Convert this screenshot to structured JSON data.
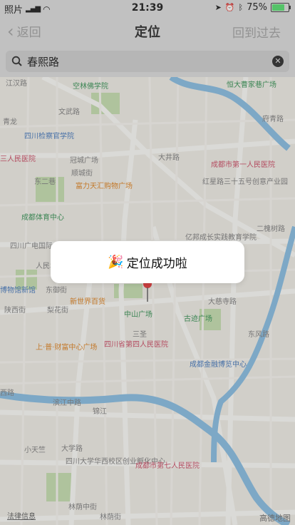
{
  "status": {
    "left_label": "照片",
    "time": "21:39",
    "battery": "75%",
    "battery_level": 0.75
  },
  "nav": {
    "back": "返回",
    "title": "定位",
    "right": "回到过去"
  },
  "search": {
    "value": "春熙路"
  },
  "toast": {
    "text": "定位成功啦",
    "icon": "party-popper-icon"
  },
  "map": {
    "legal": "法律信息",
    "brand": "高德地图",
    "labels": [
      {
        "t": "江汉路",
        "c": "street"
      },
      {
        "t": "空林佛学院",
        "c": "green"
      },
      {
        "t": "恒大曹家巷广场",
        "c": "green"
      },
      {
        "t": "青龙",
        "c": "street"
      },
      {
        "t": "文武路",
        "c": "street"
      },
      {
        "t": "府青路",
        "c": "street"
      },
      {
        "t": "四川检察官学院",
        "c": "blue"
      },
      {
        "t": "成都市第一人民医院",
        "c": "red"
      },
      {
        "t": "三人民医院",
        "c": "red"
      },
      {
        "t": "冠城广场",
        "c": "street"
      },
      {
        "t": "大井路",
        "c": "street"
      },
      {
        "t": "顺城街",
        "c": "street"
      },
      {
        "t": "东二巷",
        "c": "street"
      },
      {
        "t": "富力天汇购物广场",
        "c": "orange"
      },
      {
        "t": "红星路三十五号创意产业园",
        "c": "street"
      },
      {
        "t": "成都体育中心",
        "c": "green"
      },
      {
        "t": "二槐树路",
        "c": "street"
      },
      {
        "t": "亿邦成长实践教育学院",
        "c": "street"
      },
      {
        "t": "四川广电国际",
        "c": "street"
      },
      {
        "t": "人民北",
        "c": "street"
      },
      {
        "t": "博物馆新馆",
        "c": "blue"
      },
      {
        "t": "东御街",
        "c": "street"
      },
      {
        "t": "新世界百货",
        "c": "orange"
      },
      {
        "t": "大慈寺路",
        "c": "street"
      },
      {
        "t": "陕西街",
        "c": "street"
      },
      {
        "t": "梨花街",
        "c": "street"
      },
      {
        "t": "中山广场",
        "c": "green"
      },
      {
        "t": "古迹广场",
        "c": "green"
      },
      {
        "t": "三圣",
        "c": "street"
      },
      {
        "t": "东风路",
        "c": "street"
      },
      {
        "t": "上·普·财富中心广场",
        "c": "orange"
      },
      {
        "t": "四川省第四人民医院",
        "c": "red"
      },
      {
        "t": "成都金融博览中心",
        "c": "blue"
      },
      {
        "t": "西路",
        "c": "street"
      },
      {
        "t": "滨江中路",
        "c": "street"
      },
      {
        "t": "锦江",
        "c": "street"
      },
      {
        "t": "小天竺",
        "c": "street"
      },
      {
        "t": "大学路",
        "c": "street"
      },
      {
        "t": "四川大学华西校区创业孵化中心",
        "c": "street"
      },
      {
        "t": "成都市第七人民医院",
        "c": "red"
      },
      {
        "t": "林荫中街",
        "c": "street"
      },
      {
        "t": "林荫街",
        "c": "street"
      }
    ]
  }
}
